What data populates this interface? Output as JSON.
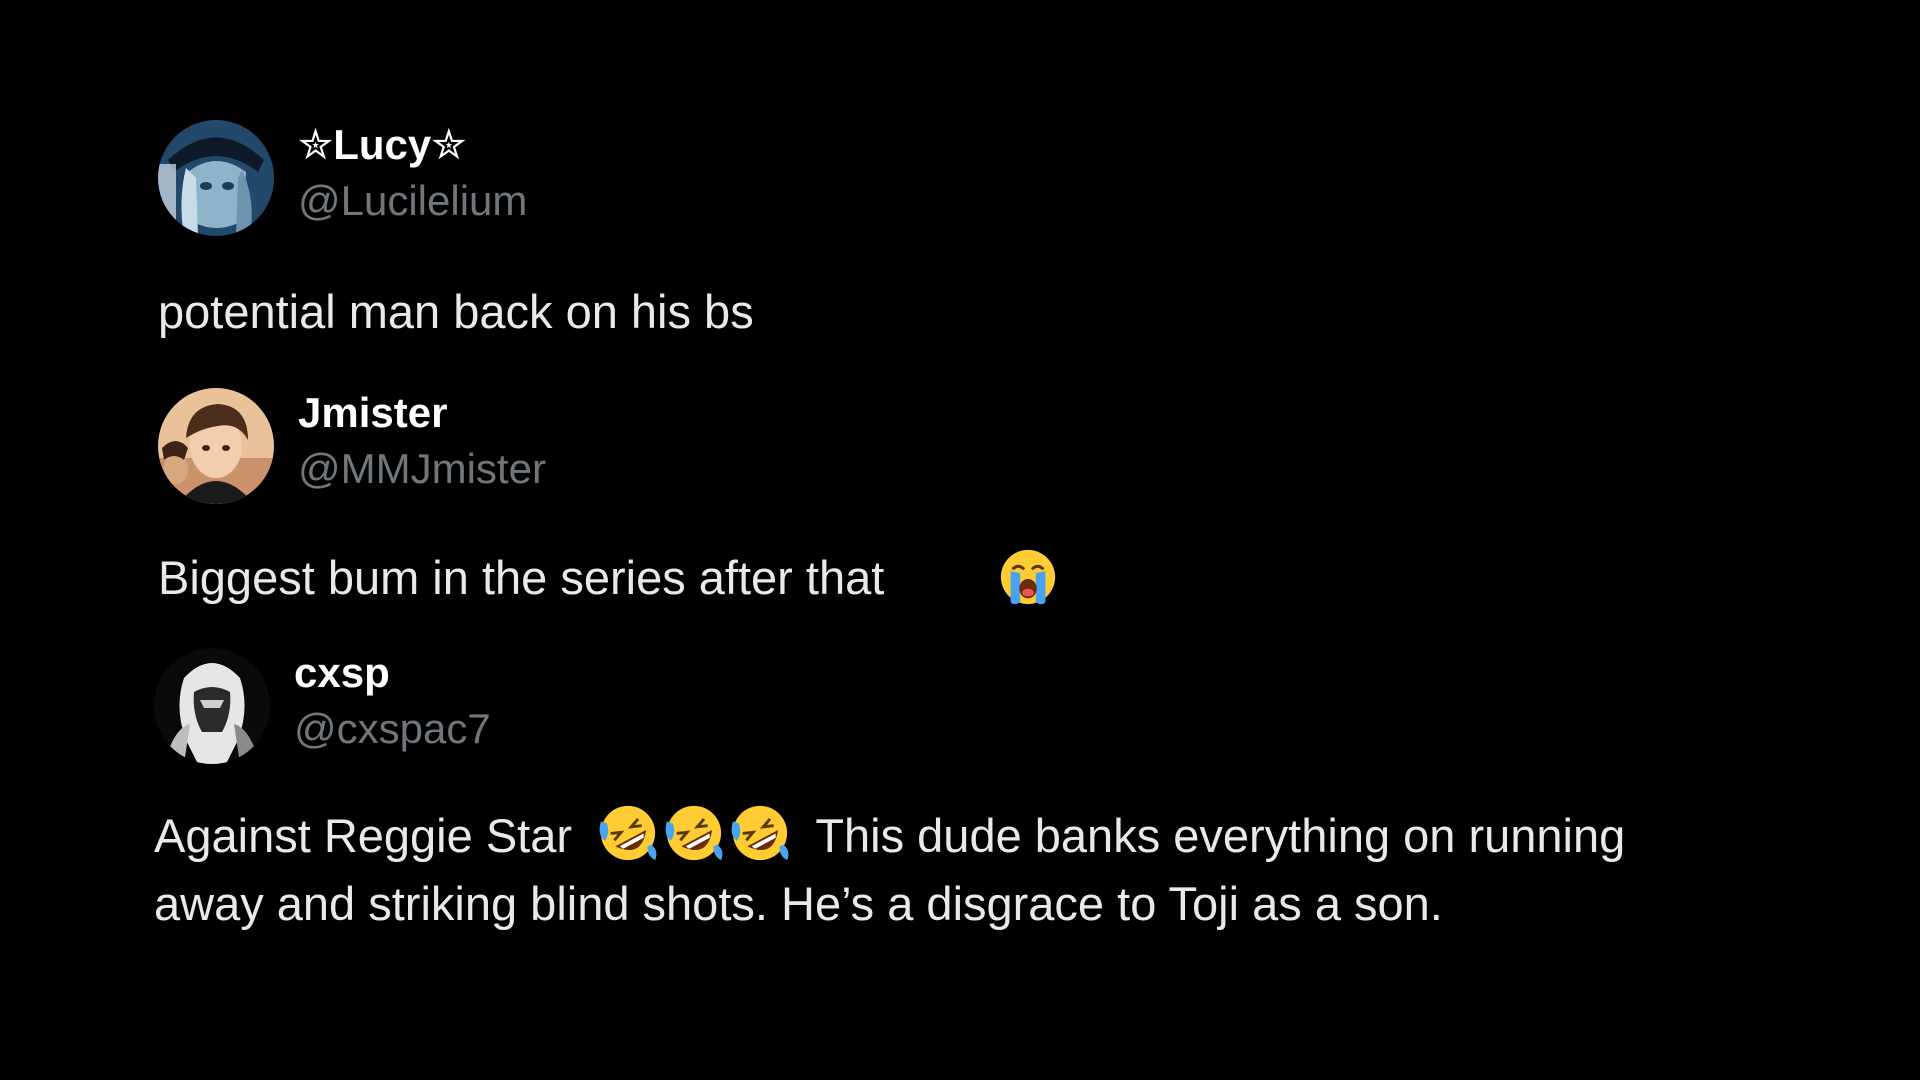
{
  "posts": [
    {
      "display_name": "✮Lucy✮",
      "handle": "@Lucilelium",
      "text": "potential man back on his bs",
      "avatar_icon": "anime-girl-cap-avatar"
    },
    {
      "display_name": "Jmister",
      "handle": "@MMJmister",
      "text_before": "Biggest bum in the series after that",
      "emoji": "loudly-crying-face-emoji",
      "avatar_icon": "anime-boy-brown-hair-avatar"
    },
    {
      "display_name": "cxsp",
      "handle": "@cxspac7",
      "text_before": "Against Reggie Star",
      "emojis": [
        "rolling-on-floor-laughing-emoji",
        "rolling-on-floor-laughing-emoji",
        "rolling-on-floor-laughing-emoji"
      ],
      "text_after": "This dude banks everything on running away and striking blind shots. He’s a disgrace to Toji as a son.",
      "avatar_icon": "monochrome-masked-figure-avatar"
    }
  ],
  "colors": {
    "background": "#000000",
    "display_name": "#ffffff",
    "handle": "#71767b",
    "body_text": "#e7e9ea"
  }
}
